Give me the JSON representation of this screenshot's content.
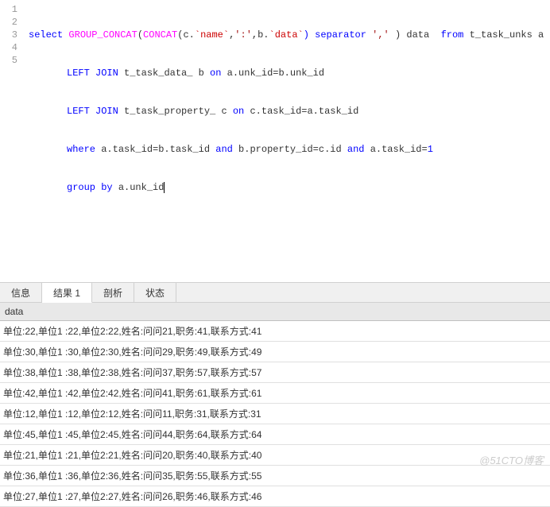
{
  "editor": {
    "gutter": [
      "1",
      "2",
      "3",
      "4",
      "5"
    ],
    "lines": {
      "l1": {
        "kw_select": "select",
        "fn_gc": "GROUP_CONCAT",
        "op1": "(",
        "fn_concat": "CONCAT",
        "op2": "(c.",
        "bt_name": "`name`",
        "op3": ",",
        "str_colon": "':'",
        "op4": ",b.",
        "bt_data": "`data`",
        "kw_sep": ") separator",
        "str_comma": " ',' ",
        "op5": ") data  ",
        "kw_from": "from",
        "rest": " t_task_unks a"
      },
      "l2": {
        "kw_left": "LEFT",
        "kw_join": " JOIN",
        "rest1": " t_task_data_ b ",
        "kw_on": "on",
        "rest2": " a.unk_id=b.unk_id"
      },
      "l3": {
        "kw_left": "LEFT",
        "kw_join": " JOIN",
        "rest1": " t_task_property_ c ",
        "kw_on": "on",
        "rest2": " c.task_id=a.task_id"
      },
      "l4": {
        "kw_where": "where",
        "rest1": " a.task_id=b.task_id ",
        "kw_and1": "and",
        "rest2": " b.property_id=c.id ",
        "kw_and2": "and",
        "rest3": " a.task_id=",
        "num": "1"
      },
      "l5": {
        "kw_group": "group",
        "kw_by": " by",
        "rest": " a.unk_id"
      }
    }
  },
  "tabs": {
    "t0": "信息",
    "t1": "结果 1",
    "t2": "剖析",
    "t3": "状态"
  },
  "results": {
    "header": "data",
    "rows": [
      "单位:22,单位1 :22,单位2:22,姓名:问问21,职务:41,联系方式:41",
      "单位:30,单位1 :30,单位2:30,姓名:问问29,职务:49,联系方式:49",
      "单位:38,单位1 :38,单位2:38,姓名:问问37,职务:57,联系方式:57",
      "单位:42,单位1 :42,单位2:42,姓名:问问41,职务:61,联系方式:61",
      "单位:12,单位1 :12,单位2:12,姓名:问问11,职务:31,联系方式:31",
      "单位:45,单位1 :45,单位2:45,姓名:问问44,职务:64,联系方式:64",
      "单位:21,单位1 :21,单位2:21,姓名:问问20,职务:40,联系方式:40",
      "单位:36,单位1 :36,单位2:36,姓名:问问35,职务:55,联系方式:55",
      "单位:27,单位1 :27,单位2:27,姓名:问问26,职务:46,联系方式:46"
    ]
  },
  "watermark": "@51CTO博客"
}
